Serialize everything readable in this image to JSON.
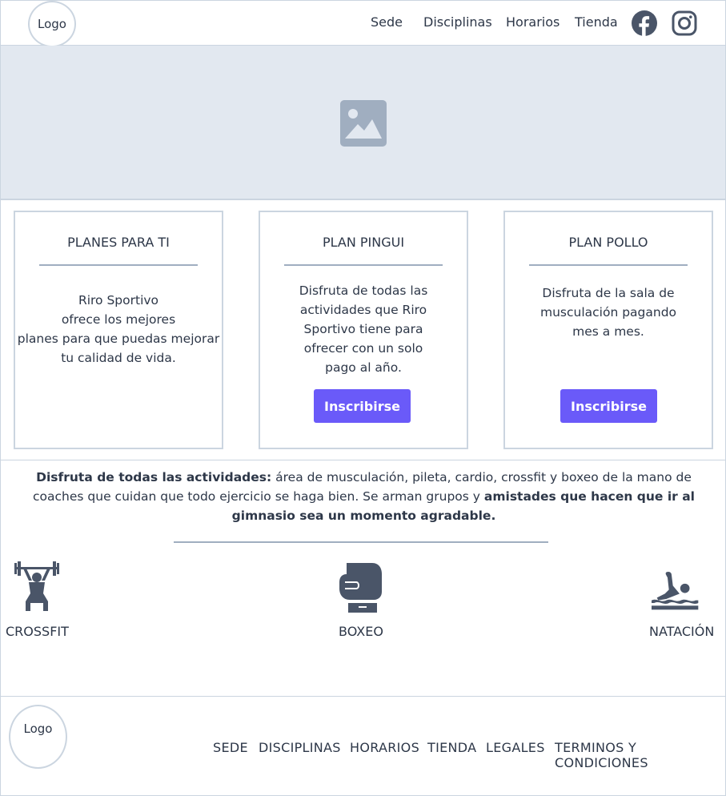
{
  "header": {
    "logo": "Logo",
    "nav": [
      "Sede",
      "Disciplinas",
      "Horarios",
      "Tienda"
    ]
  },
  "plans": [
    {
      "title": "PLANES PARA TI",
      "text": "Riro Sportivo\nofrece los mejores\nplanes para que puedas mejorar\ntu calidad de vida."
    },
    {
      "title": "PLAN PINGUI",
      "text": "Disfruta de todas las\nactividades que Riro\nSportivo tiene para\nofrecer con un solo\npago al año.",
      "button": "Inscribirse"
    },
    {
      "title": "PLAN POLLO",
      "text": "Disfruta de la sala de\nmusculación pagando\nmes a mes.",
      "button": "Inscribirse"
    }
  ],
  "activities": {
    "intro_bold": "Disfruta de todas las actividades:",
    "intro_text": " área de musculación, pileta, cardio, crossfit y boxeo de la mano de coaches que cuidan que todo ejercicio se haga bien. Se arman grupos y ",
    "outro_bold": "amistades que hacen que ir al gimnasio sea un momento agradable.",
    "items": [
      {
        "label": "CROSSFIT",
        "icon": "weightlifting-icon"
      },
      {
        "label": "BOXEO",
        "icon": "boxing-glove-icon"
      },
      {
        "label": "NATACIÓN",
        "icon": "swimmer-icon"
      }
    ]
  },
  "footer": {
    "logo": "Logo",
    "nav": [
      "SEDE",
      "DISCIPLINAS",
      "HORARIOS",
      "TIENDA",
      "LEGALES",
      "TERMINOS Y CONDICIONES"
    ]
  },
  "colors": {
    "accent": "#6a5af9",
    "border": "#cbd5e0",
    "hero_bg": "#e2e8f0",
    "icon": "#4a5568"
  }
}
